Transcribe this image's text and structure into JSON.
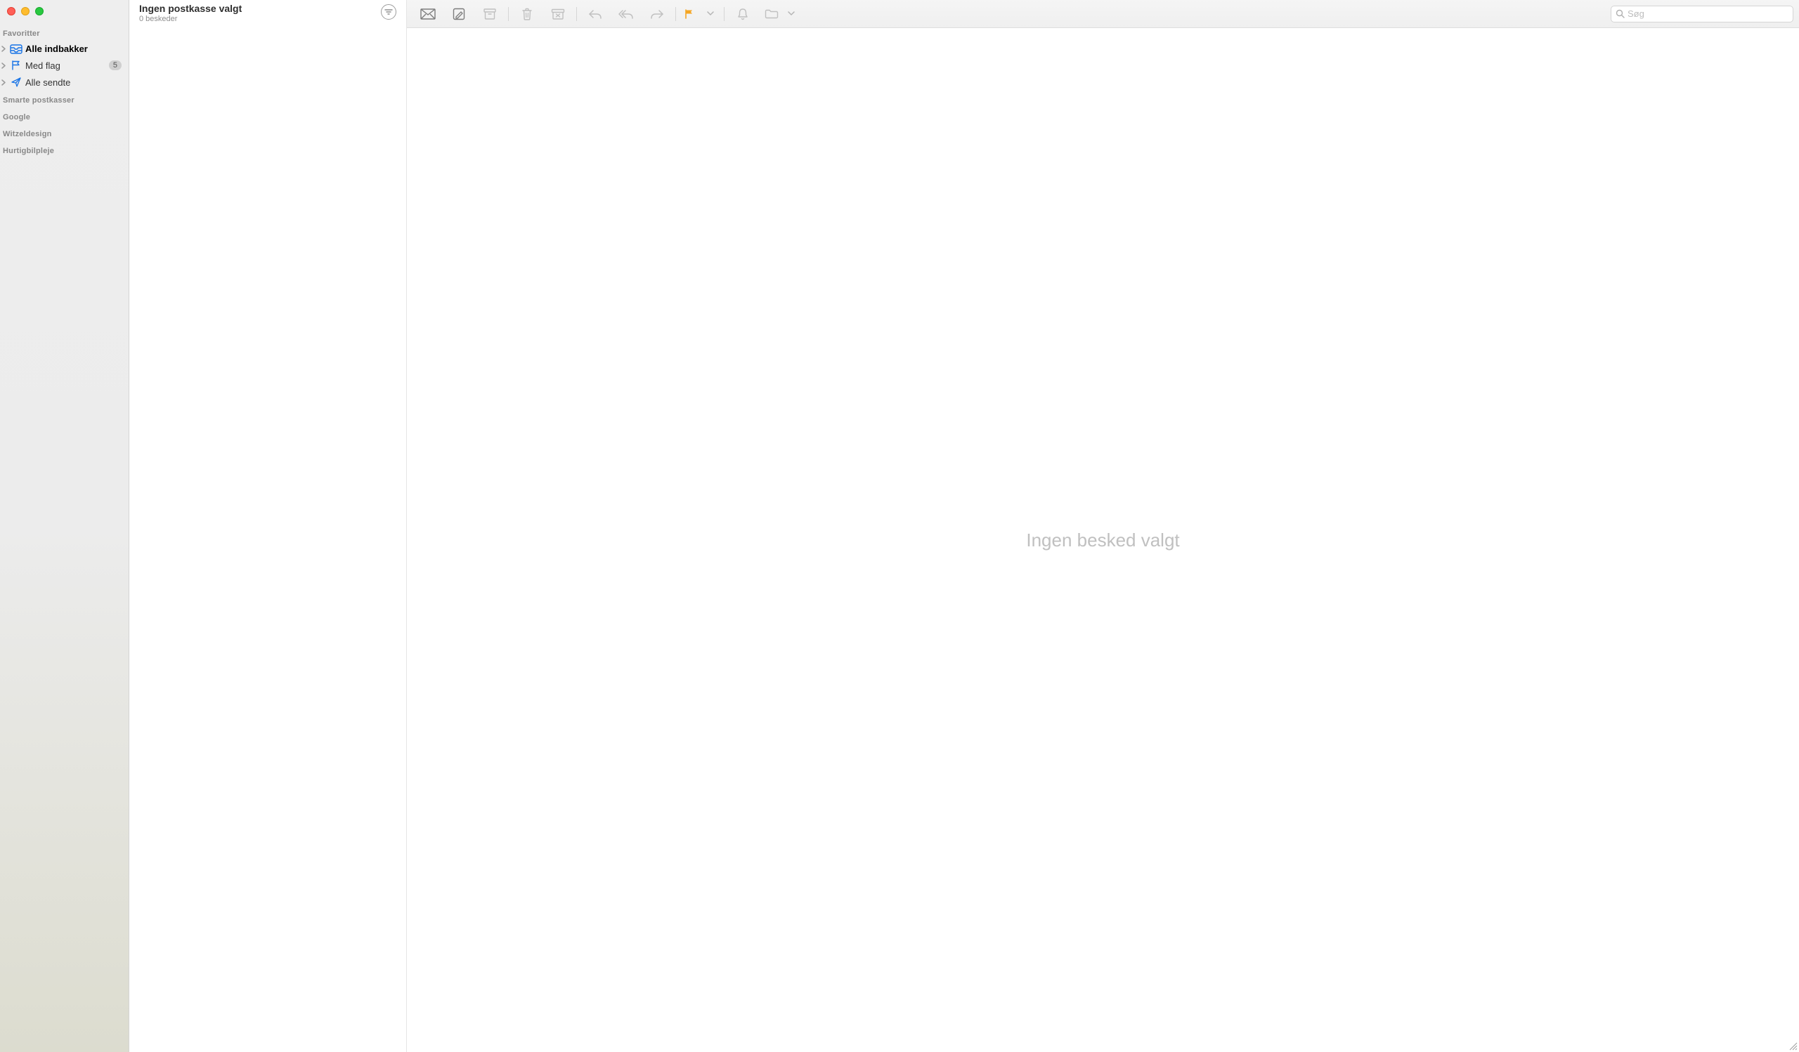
{
  "sidebar": {
    "sections": {
      "favorites_label": "Favoritter",
      "smart_label": "Smarte postkasser",
      "account1_label": "Google",
      "account2_label": "Witzeldesign",
      "account3_label": "Hurtigbilpleje"
    },
    "items": {
      "inbox_label": "Alle indbakker",
      "flagged_label": "Med flag",
      "flagged_count": "5",
      "sent_label": "Alle sendte"
    }
  },
  "messagelist": {
    "title": "Ingen postkasse valgt",
    "subtitle": "0 beskeder"
  },
  "toolbar": {
    "search_placeholder": "Søg"
  },
  "content": {
    "empty_message": "Ingen besked valgt"
  },
  "colors": {
    "accent": "#1773e6",
    "flag": "#f5a623"
  }
}
